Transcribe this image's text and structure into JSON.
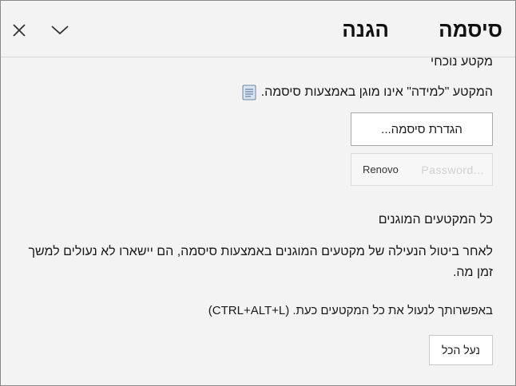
{
  "header": {
    "tab_password": "סיסמה",
    "tab_protect": "הגנה",
    "close_icon": "close-icon",
    "collapse_icon": "chevron-down-icon"
  },
  "current_section": {
    "title": "מקטע נוכחי",
    "notice": "המקטע \"למידה\" אינו מוגן באמצעות סיסמה.",
    "set_password_button": "הגדרת סיסמה...",
    "change_password_button": "Password...",
    "renew_button": "Renovo"
  },
  "all_sections": {
    "title": "כל המקטעים המוגנים",
    "description": "לאחר ביטול הנעילה של מקטעים המוגנים באמצעות סיסמה, הם יישארו לא נעולים למשך זמן מה.",
    "shortcut_text": "באפשרותך לנעול את כל המקטעים כעת. (CTRL+ALT+L)",
    "lock_all_button": "נעל הכל"
  },
  "colors": {
    "background": "#f3f3f3",
    "border": "#8a8a8a",
    "button_bg": "#ffffff",
    "disabled_text": "#bdbdbd"
  }
}
